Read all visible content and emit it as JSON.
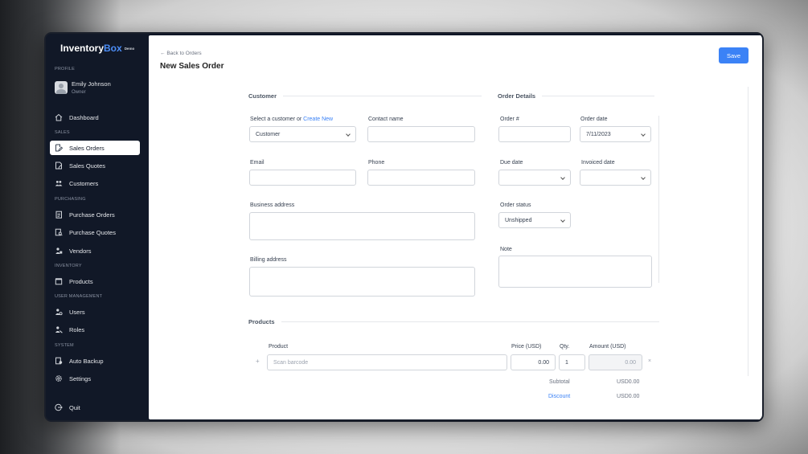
{
  "app": {
    "name_part1": "Inventory",
    "name_part2": "Box",
    "badge": "Demo",
    "brand_color": "#4c8ef7"
  },
  "sidebar": {
    "profile_section": "PROFILE",
    "user_name": "Emily Johnson",
    "user_role": "Owner",
    "dashboard": "Dashboard",
    "sections": {
      "sales": "SALES",
      "purchasing": "PURCHASING",
      "inventory": "INVENTORY",
      "user_management": "USER MANAGEMENT",
      "system": "SYSTEM"
    },
    "items": {
      "sales_orders": "Sales Orders",
      "sales_quotes": "Sales Quotes",
      "customers": "Customers",
      "purchase_orders": "Purchase Orders",
      "purchase_quotes": "Purchase Quotes",
      "vendors": "Vendors",
      "products": "Products",
      "users": "Users",
      "roles": "Roles",
      "auto_backup": "Auto Backup",
      "settings": "Settings",
      "quit": "Quit"
    },
    "active_item": "sales_orders"
  },
  "header": {
    "back_link": "Back to Orders",
    "title": "New Sales Order",
    "save_label": "Save",
    "accent_color": "#3b82f6"
  },
  "customer": {
    "section_title": "Customer",
    "select_label": "Select a customer or ",
    "create_new": "Create New",
    "select_value": "Customer",
    "contact_label": "Contact name",
    "contact_value": "",
    "email_label": "Email",
    "email_value": "",
    "phone_label": "Phone",
    "phone_value": "",
    "business_address_label": "Business address",
    "billing_address_label": "Billing address"
  },
  "order_details": {
    "section_title": "Order Details",
    "order_no_label": "Order #",
    "order_no_value": "",
    "order_date_label": "Order date",
    "order_date_value": "7/11/2023",
    "due_date_label": "Due date",
    "due_date_value": "",
    "invoiced_date_label": "Invoiced date",
    "invoiced_date_value": "",
    "status_label": "Order status",
    "status_value": "Unshipped",
    "note_label": "Note"
  },
  "products": {
    "section_title": "Products",
    "columns": {
      "product": "Product",
      "price": "Price (USD)",
      "qty": "Qty.",
      "amount": "Amount (USD)"
    },
    "row": {
      "product_placeholder": "Scan barcode",
      "price": "0.00",
      "qty": "1",
      "amount": "0.00",
      "remove_glyph": "×",
      "add_glyph": "+"
    },
    "subtotal_label": "Subtotal",
    "subtotal_value": "USD0.00",
    "discount_label": "Discount",
    "discount_value": "USD0.00"
  }
}
